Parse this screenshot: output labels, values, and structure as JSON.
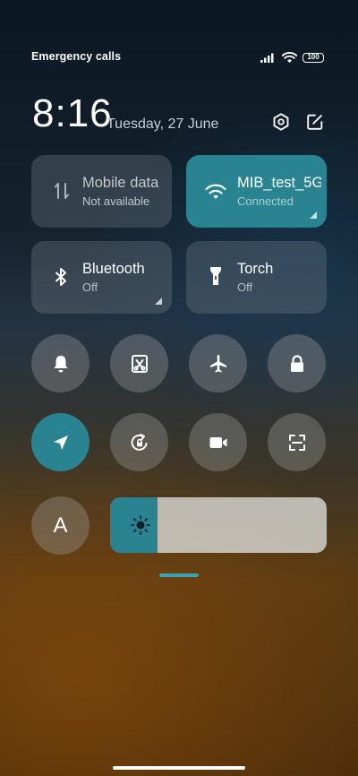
{
  "status_bar": {
    "carrier_text": "Emergency calls o",
    "battery_level": "100",
    "icons": [
      "signal-icon",
      "wifi-icon",
      "battery-icon"
    ]
  },
  "header": {
    "time": "8:16",
    "date": "Tuesday, 27 June",
    "icons": [
      "settings-icon",
      "edit-icon"
    ]
  },
  "tiles": [
    {
      "title": "Mobile data",
      "subtitle": "Not available",
      "icon": "mobile-data-icon",
      "active": false
    },
    {
      "title": "MIB_test_5G",
      "subtitle": "Connected",
      "icon": "wifi-icon",
      "active": true
    },
    {
      "title": "Bluetooth",
      "subtitle": "Off",
      "icon": "bluetooth-icon",
      "active": false
    },
    {
      "title": "Torch",
      "subtitle": "Off",
      "icon": "torch-icon",
      "active": false
    }
  ],
  "toggles": [
    {
      "name": "bell-icon",
      "active": false
    },
    {
      "name": "screenshot-icon",
      "active": false
    },
    {
      "name": "airplane-icon",
      "active": false
    },
    {
      "name": "lock-icon",
      "active": false
    },
    {
      "name": "location-icon",
      "active": true
    },
    {
      "name": "rotation-lock-icon",
      "active": false
    },
    {
      "name": "video-camera-icon",
      "active": false
    },
    {
      "name": "scanner-icon",
      "active": false
    }
  ],
  "auto_brightness": {
    "label": "A"
  },
  "brightness": {
    "level": 0.22,
    "icon": "sun-icon"
  },
  "colors": {
    "accent": "#2a8391",
    "handle": "#3aa0b4"
  }
}
